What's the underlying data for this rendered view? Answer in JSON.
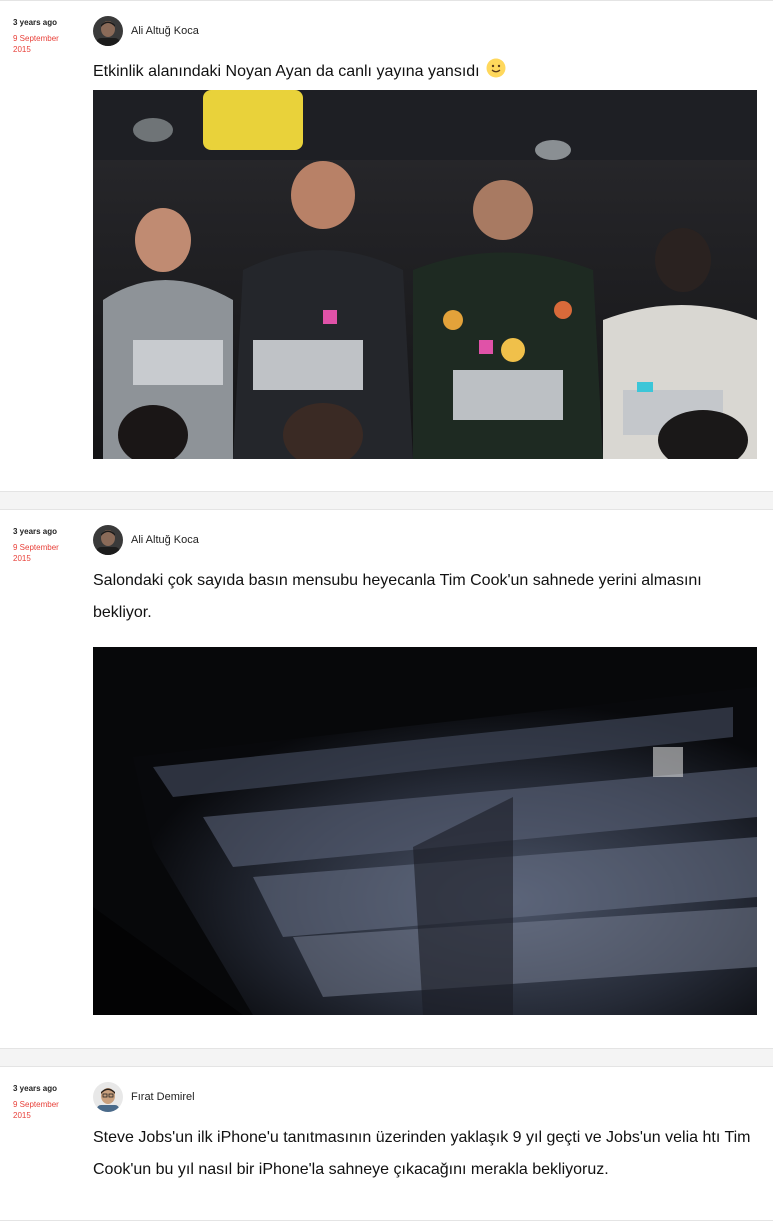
{
  "posts": [
    {
      "time_ago": "3 years ago",
      "date": "9 September 2015",
      "author": "Ali Altuğ Koca",
      "text": "Etkinlik alanındaki Noyan Ayan da canlı yayına yansıdı",
      "emoji": "slightly-smiling-face-icon"
    },
    {
      "time_ago": "3 years ago",
      "date": "9 September 2015",
      "author": "Ali Altuğ Koca",
      "text": "Salondaki çok sayıda basın mensubu heyecanla Tim Cook'un sahnede yerini almasını bekliyor."
    },
    {
      "time_ago": "3 years ago",
      "date": "9 September 2015",
      "author": "Fırat Demirel",
      "text": "Steve Jobs'un ilk iPhone'u tanıtmasının üzerinden yaklaşık 9 yıl geçti ve Jobs'un velia htı Tim Cook'un bu yıl nasıl bir iPhone'la sahneye çıkacağını merakla bekliyoruz."
    }
  ],
  "colors": {
    "date_accent": "#e8413a",
    "page_background": "#f4f4f4",
    "card_background": "#ffffff"
  }
}
